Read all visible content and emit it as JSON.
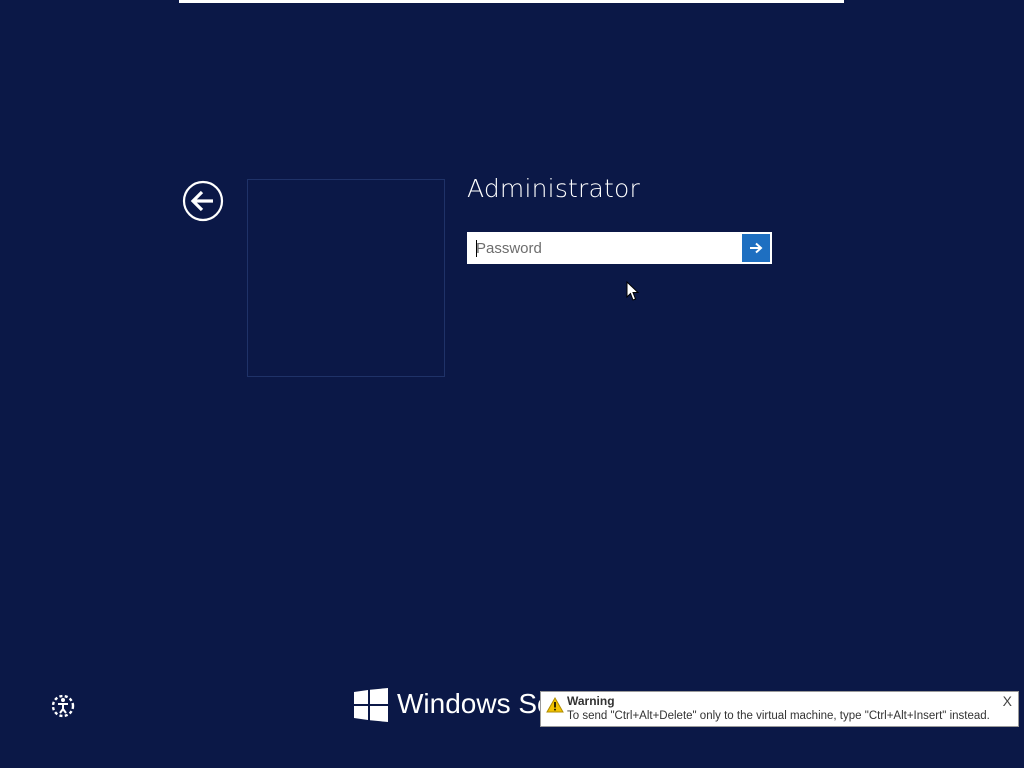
{
  "login": {
    "username": "Administrator",
    "password_placeholder": "Password",
    "password_value": ""
  },
  "branding": {
    "product_text": "Windows Server"
  },
  "warning": {
    "title": "Warning",
    "message": "To send \"Ctrl+Alt+Delete\" only to the virtual machine, type \"Ctrl+Alt+Insert\" instead.",
    "close_label": "X"
  },
  "icons": {
    "back": "back-arrow-icon",
    "submit": "arrow-right-icon",
    "ease_of_access": "ease-of-access-icon",
    "windows": "windows-logo-icon",
    "warning": "warning-triangle-icon"
  },
  "colors": {
    "background": "#0b1847",
    "accent": "#1e6fc1",
    "text": "#ffffff"
  }
}
